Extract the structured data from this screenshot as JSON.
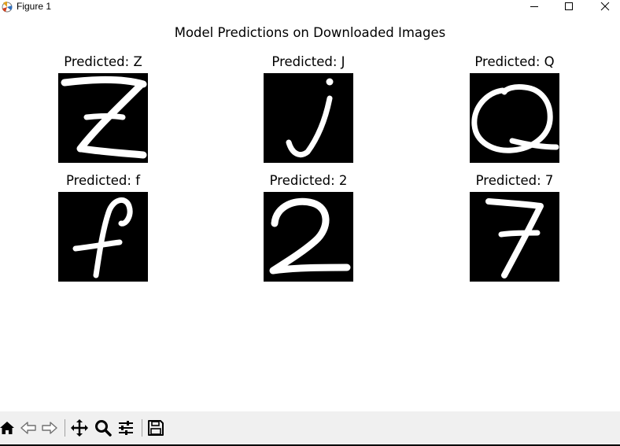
{
  "window": {
    "title": "Figure 1",
    "icon": "matplotlib-icon",
    "controls": [
      "minimize-icon",
      "maximize-icon",
      "close-icon"
    ]
  },
  "figure": {
    "suptitle": "Model Predictions on Downloaded Images",
    "panels": [
      {
        "title": "Predicted: Z",
        "glyph": "Z"
      },
      {
        "title": "Predicted: J",
        "glyph": "j"
      },
      {
        "title": "Predicted: Q",
        "glyph": "Q"
      },
      {
        "title": "Predicted: f",
        "glyph": "f"
      },
      {
        "title": "Predicted: 2",
        "glyph": "2"
      },
      {
        "title": "Predicted: 7",
        "glyph": "7"
      }
    ]
  },
  "toolbar": {
    "buttons": [
      "home-icon",
      "back-icon",
      "forward-icon",
      "pan-icon",
      "zoom-icon",
      "configure-subplots-icon",
      "save-icon"
    ]
  },
  "colors": {
    "image_background": "#000000",
    "stroke": "#ffffff",
    "toolbar_background": "#f0f0f0"
  }
}
